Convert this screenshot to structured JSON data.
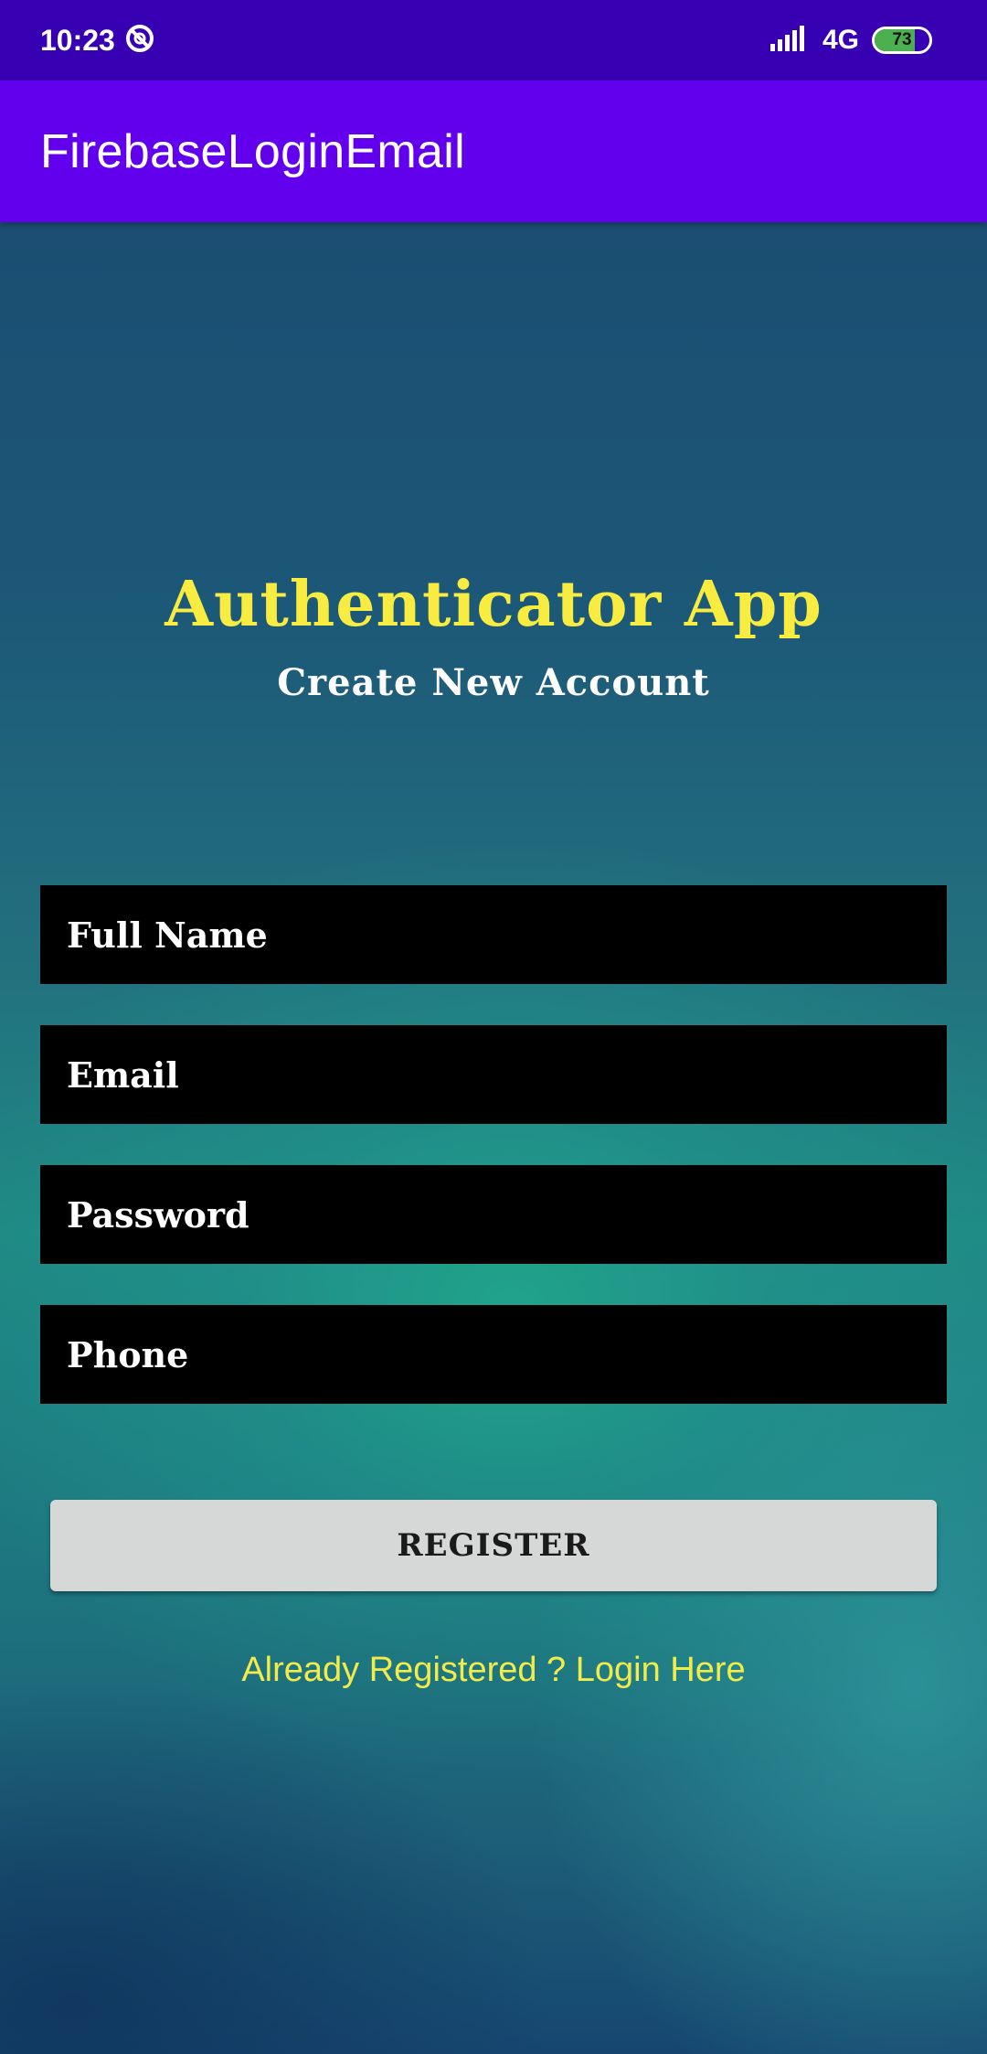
{
  "status_bar": {
    "time": "10:23",
    "network": "4G",
    "battery_percent": "73",
    "battery_level": 0.73,
    "icons": [
      "dnd-icon",
      "signal-icon",
      "battery-icon"
    ]
  },
  "app_bar": {
    "title": "FirebaseLoginEmail"
  },
  "main": {
    "title": "Authenticator App",
    "subtitle": "Create New Account",
    "fields": {
      "full_name": {
        "placeholder": "Full Name",
        "value": ""
      },
      "email": {
        "placeholder": "Email",
        "value": ""
      },
      "password": {
        "placeholder": "Password",
        "value": ""
      },
      "phone": {
        "placeholder": "Phone",
        "value": ""
      }
    },
    "register_label": "REGISTER",
    "login_link": "Already Registered ? Login Here"
  },
  "colors": {
    "status_bar": "#3700b3",
    "app_bar": "#6200ee",
    "title": "#f7ec3f",
    "link": "#f2ec4a",
    "field_bg": "#000000",
    "button_bg": "#d6d7d7"
  }
}
